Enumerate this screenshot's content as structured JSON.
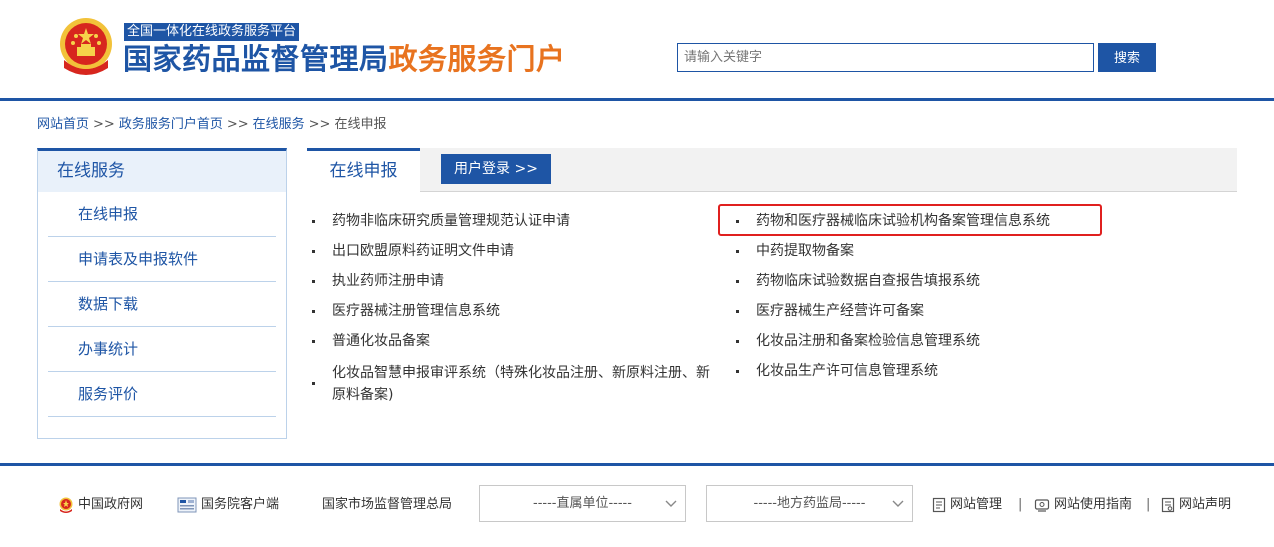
{
  "header": {
    "platform_tag": "全国一体化在线政务服务平台",
    "title_main": "国家药品监督管理局",
    "title_accent": "政务服务门户",
    "search_placeholder": "请输入关键字",
    "search_button": "搜索"
  },
  "breadcrumb": {
    "items": [
      "网站首页",
      "政务服务门户首页",
      "在线服务",
      "在线申报"
    ],
    "separator": ">>"
  },
  "sidebar": {
    "title": "在线服务",
    "items": [
      "在线申报",
      "申请表及申报软件",
      "数据下载",
      "办事统计",
      "服务评价"
    ]
  },
  "main": {
    "active_tab": "在线申报",
    "login_button": "用户登录 >>",
    "left_items": [
      "药物非临床研究质量管理规范认证申请",
      "出口欧盟原料药证明文件申请",
      "执业药师注册申请",
      "医疗器械注册管理信息系统",
      "普通化妆品备案",
      "化妆品智慧申报审评系统（特殊化妆品注册、新原料注册、新原料备案)"
    ],
    "right_items": [
      "药物和医疗器械临床试验机构备案管理信息系统",
      "中药提取物备案",
      "药物临床试验数据自查报告填报系统",
      "医疗器械生产经营许可备案",
      "化妆品注册和备案检验信息管理系统",
      "化妆品生产许可信息管理系统"
    ]
  },
  "footer": {
    "links": [
      "中国政府网",
      "国务院客户端",
      "国家市场监督管理总局"
    ],
    "select_direct": "-----直属单位-----",
    "select_local": "-----地方药监局-----",
    "right_links": [
      "网站管理",
      "网站使用指南",
      "网站声明"
    ],
    "separator": "|"
  },
  "colors": {
    "brand_blue": "#1e55a5",
    "accent_orange": "#e8731f",
    "highlight_red": "#e0201f"
  }
}
